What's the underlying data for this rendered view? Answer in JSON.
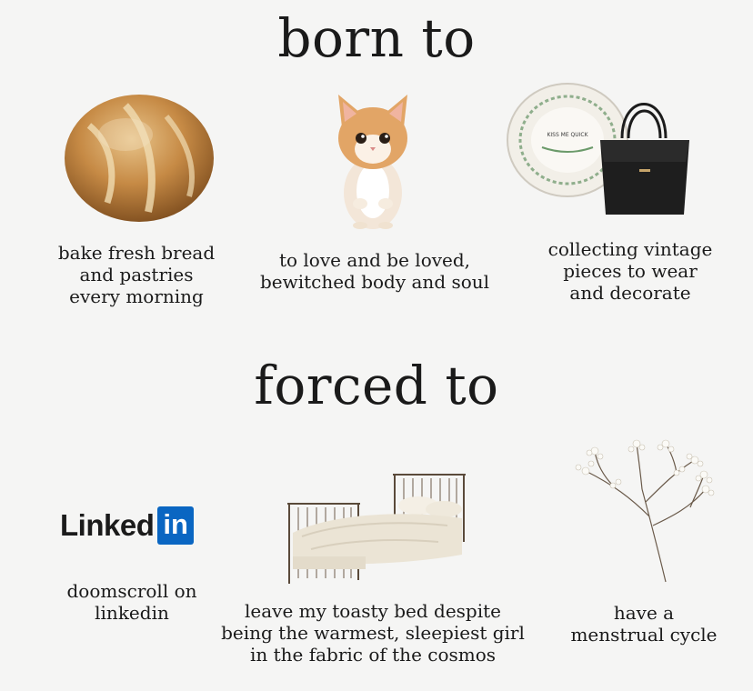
{
  "born_section": {
    "title": "born to",
    "items": [
      {
        "caption": "bake fresh bread\nand pastries\nevery morning",
        "image": "bread-loaf"
      },
      {
        "caption": "to love and be loved,\nbewitched body and soul",
        "image": "kitten"
      },
      {
        "caption": "collecting vintage\npieces to wear\nand decorate",
        "image": "plate-and-handbag",
        "plate_text": "KISS ME QUICK"
      }
    ]
  },
  "forced_section": {
    "title": "forced to",
    "items": [
      {
        "caption": "doomscroll on\nlinkedin",
        "image": "linkedin-logo",
        "logo_word": "Linked",
        "logo_badge": "in"
      },
      {
        "caption": "leave my toasty bed despite\nbeing the warmest, sleepiest girl\nin the fabric of the cosmos",
        "image": "bed"
      },
      {
        "caption": "have a\nmenstrual cycle",
        "image": "babys-breath-flower"
      }
    ]
  },
  "colors": {
    "background": "#f5f5f4",
    "linkedin_blue": "#0a66c2",
    "text": "#1a1a1a"
  }
}
